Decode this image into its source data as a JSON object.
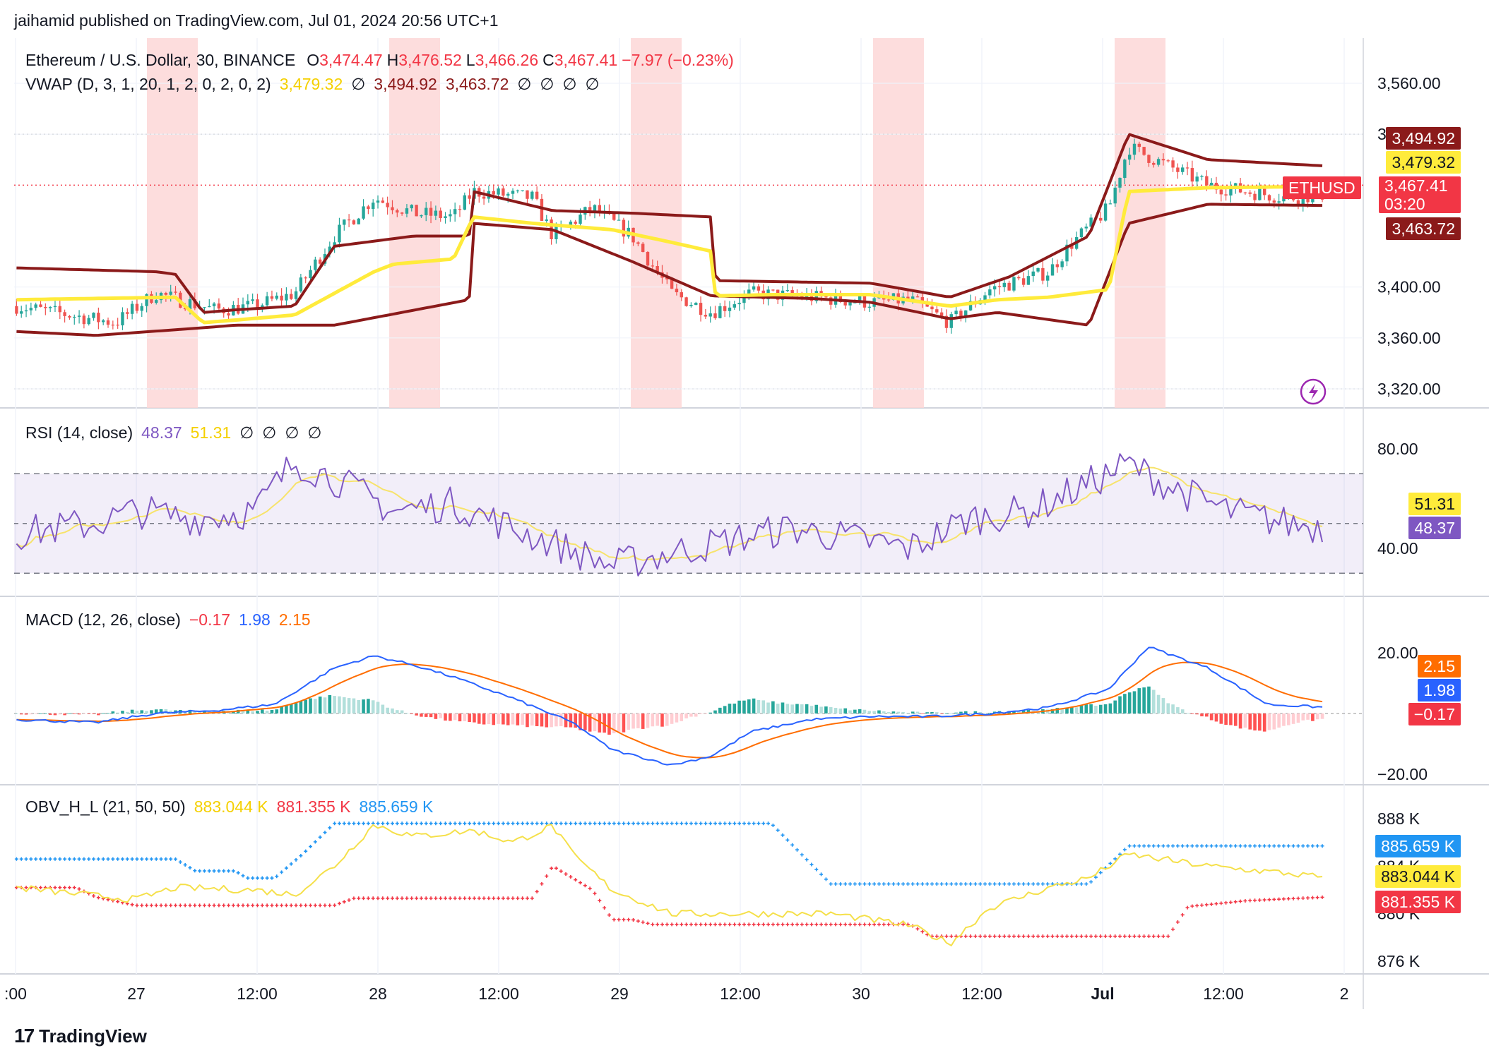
{
  "header": {
    "publish_line": "jaihamid published on TradingView.com, Jul 01, 2024 20:56 UTC+1"
  },
  "price_pane": {
    "symbol": "Ethereum / U.S. Dollar, 30, BINANCE",
    "o_label": "O",
    "o": "3,474.47",
    "h_label": "H",
    "h": "3,476.52",
    "l_label": "L",
    "l": "3,466.26",
    "c_label": "C",
    "c": "3,467.41",
    "change": "−7.97 (−0.23%)",
    "vwap_label": "VWAP (D, 3, 1, 20, 1, 2, 0, 2, 0, 2)",
    "vwap": "3,479.32",
    "vwap_upper": "3,494.92",
    "vwap_lower": "3,463.72",
    "empty_symbol": "∅",
    "ticker_tag": "ETHUSD",
    "last_price": "3,467.41",
    "countdown": "03:20",
    "y_ticks": [
      "3,560.00",
      "3,520.00",
      "3,400.00",
      "3,360.00",
      "3,320.00"
    ]
  },
  "rsi_pane": {
    "label": "RSI (14, close)",
    "rsi": "48.37",
    "rsi_ma": "51.31",
    "empty_symbol": "∅",
    "y_ticks": [
      "80.00",
      "40.00"
    ]
  },
  "macd_pane": {
    "label": "MACD (12, 26, close)",
    "hist": "−0.17",
    "macd": "1.98",
    "signal": "2.15",
    "y_ticks": [
      "20.00",
      "−20.00"
    ]
  },
  "obv_pane": {
    "label": "OBV_H_L (21, 50, 50)",
    "obv": "883.044 K",
    "low": "881.355 K",
    "high": "885.659 K",
    "y_ticks": [
      "888 K",
      "884 K",
      "880 K",
      "876 K"
    ]
  },
  "x_axis": {
    "ticks": [
      ":00",
      "27",
      "12:00",
      "28",
      "12:00",
      "29",
      "12:00",
      "30",
      "12:00",
      "Jul",
      "12:00",
      "2"
    ]
  },
  "brand": {
    "logo": "17",
    "name": "TradingView"
  },
  "colors": {
    "up": "#26a69a",
    "down": "#ef5350",
    "vwap": "#ffeb3b",
    "band": "#8b1a1a",
    "rsi": "#7e57c2",
    "rsi_ma": "#f7e36b",
    "macd": "#2962ff",
    "signal": "#ff6d00",
    "obv": "#f5e04a",
    "obv_high": "#2196f3",
    "obv_low": "#f23645",
    "session": "#fcd5d5"
  },
  "chart_data": [
    {
      "type": "candlestick",
      "title": "Ethereum / U.S. Dollar, 30, BINANCE",
      "ylim": [
        3320,
        3560
      ],
      "last": {
        "open": 3474.47,
        "high": 3476.52,
        "low": 3466.26,
        "close": 3467.41
      },
      "vwap": {
        "vwap": 3479.32,
        "upper": 3494.92,
        "lower": 3463.72
      }
    },
    {
      "type": "line",
      "title": "RSI (14, close)",
      "ylim": [
        20,
        100
      ],
      "series": [
        {
          "name": "RSI",
          "last": 48.37
        },
        {
          "name": "RSI MA",
          "last": 51.31
        }
      ]
    },
    {
      "type": "line",
      "title": "MACD (12, 26, close)",
      "ylim": [
        -28,
        32
      ],
      "series": [
        {
          "name": "Histogram",
          "last": -0.17
        },
        {
          "name": "MACD",
          "last": 1.98
        },
        {
          "name": "Signal",
          "last": 2.15
        }
      ]
    },
    {
      "type": "line",
      "title": "OBV_H_L (21, 50, 50)",
      "unit": "K",
      "ylim": [
        874,
        890
      ],
      "series": [
        {
          "name": "OBV",
          "last": 883.044
        },
        {
          "name": "Low",
          "last": 881.355
        },
        {
          "name": "High",
          "last": 885.659
        }
      ]
    }
  ]
}
